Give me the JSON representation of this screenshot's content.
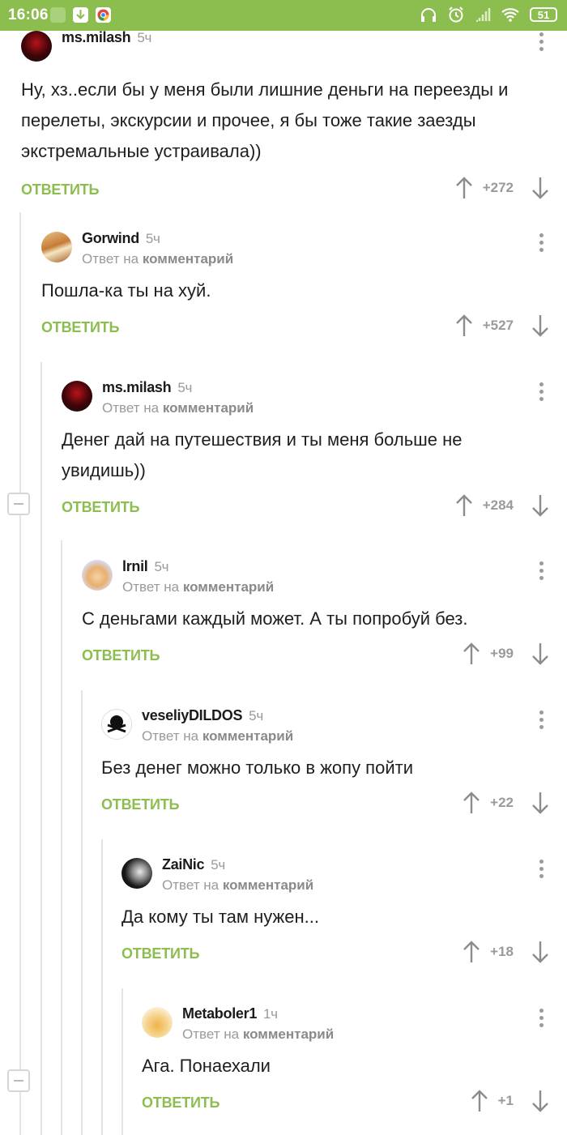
{
  "status": {
    "time": "16:06",
    "battery": "51"
  },
  "comments": [
    {
      "user": "ms.milash",
      "time": "5ч",
      "reply": false,
      "text": "Ну, хз..если бы у меня были лишние деньги на переезды и перелеты, экскурсии и прочее, я бы тоже такие заезды экстремальные устраивала))",
      "score": "+272"
    },
    {
      "user": "Gorwind",
      "time": "5ч",
      "reply": true,
      "text": "Пошла-ка ты на хуй.",
      "score": "+527"
    },
    {
      "user": "ms.milash",
      "time": "5ч",
      "reply": true,
      "text": "Денег дай на путешествия и ты меня больше не увидишь))",
      "score": "+284"
    },
    {
      "user": "lrnil",
      "time": "5ч",
      "reply": true,
      "text": "С деньгами каждый может. А ты попробуй без.",
      "score": "+99"
    },
    {
      "user": "veseliyDILDOS",
      "time": "5ч",
      "reply": true,
      "text": "Без денег можно только в жопу пойти",
      "score": "+22"
    },
    {
      "user": "ZaiNic",
      "time": "5ч",
      "reply": true,
      "text": "Да кому ты там нужен...",
      "score": "+18"
    },
    {
      "user": "Metaboler1",
      "time": "1ч",
      "reply": true,
      "text": "Ага. Понаехали",
      "score": "+1"
    }
  ],
  "labels": {
    "answer": "ОТВЕТИТЬ",
    "reply_prefix": "Ответ на",
    "reply_target": "комментарий"
  },
  "colors": {
    "accent": "#8cbd4f",
    "muted": "#9a9a9a"
  }
}
